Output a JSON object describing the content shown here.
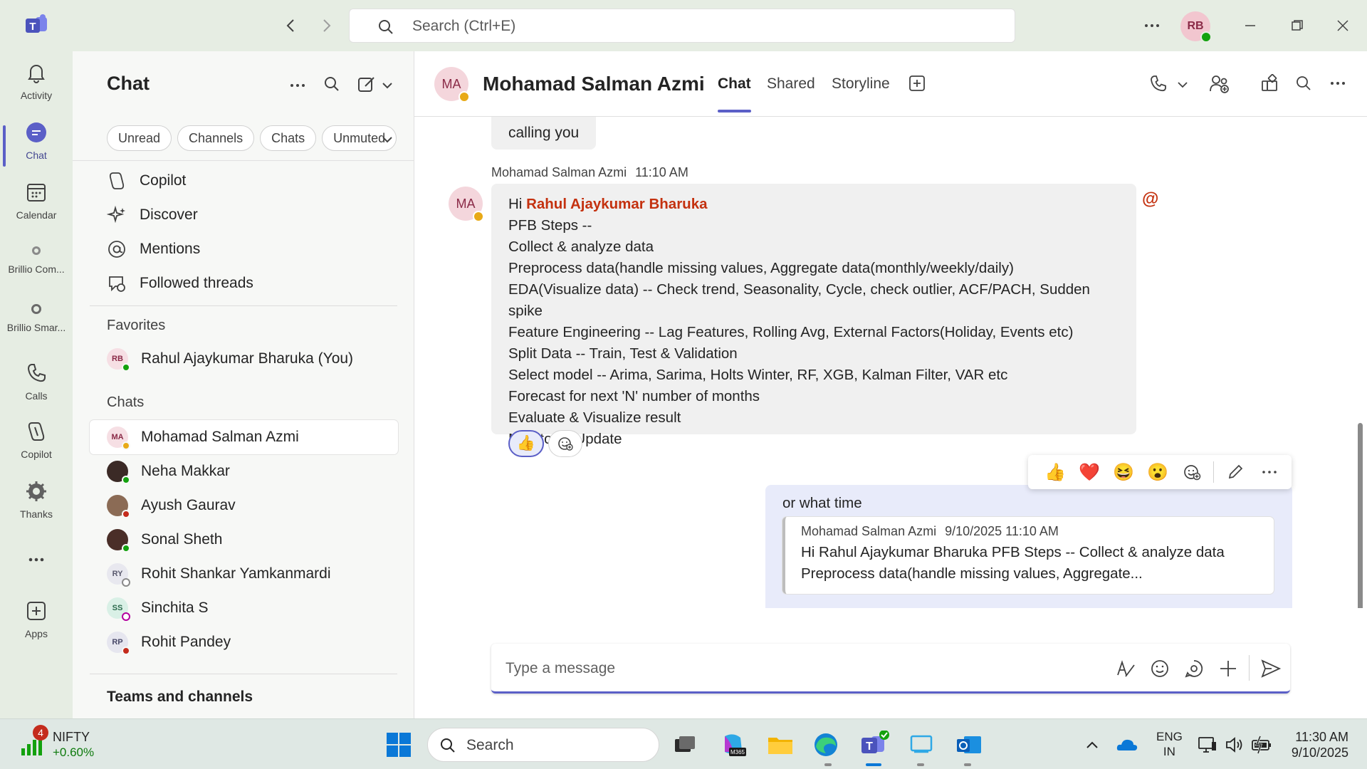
{
  "titlebar": {
    "search_placeholder": "Search (Ctrl+E)",
    "me_initials": "RB"
  },
  "rail": {
    "items": [
      {
        "label": "Activity"
      },
      {
        "label": "Chat"
      },
      {
        "label": "Calendar"
      },
      {
        "label": "Brillio Com..."
      },
      {
        "label": "Brillio Smar..."
      },
      {
        "label": "Calls"
      },
      {
        "label": "Copilot"
      },
      {
        "label": "Thanks"
      },
      {
        "label": "Apps"
      }
    ]
  },
  "sidebar": {
    "title": "Chat",
    "filters": [
      "Unread",
      "Channels",
      "Chats",
      "Unmuted"
    ],
    "nav": [
      {
        "label": "Copilot"
      },
      {
        "label": "Discover"
      },
      {
        "label": "Mentions"
      },
      {
        "label": "Followed threads"
      }
    ],
    "favorites_label": "Favorites",
    "favorites": [
      {
        "initials": "RB",
        "name": "Rahul Ajaykumar Bharuka (You)"
      }
    ],
    "chats_label": "Chats",
    "chats": [
      {
        "initials": "MA",
        "name": "Mohamad Salman Azmi"
      },
      {
        "initials": "",
        "name": "Neha Makkar"
      },
      {
        "initials": "",
        "name": "Ayush Gaurav"
      },
      {
        "initials": "",
        "name": "Sonal Sheth"
      },
      {
        "initials": "RY",
        "name": "Rohit Shankar Yamkanmardi"
      },
      {
        "initials": "SS",
        "name": "Sinchita S"
      },
      {
        "initials": "RP",
        "name": "Rohit Pandey"
      }
    ],
    "teams_label": "Teams and channels"
  },
  "header": {
    "initials": "MA",
    "name": "Mohamad Salman Azmi",
    "tabs": [
      "Chat",
      "Shared",
      "Storyline"
    ]
  },
  "thread": {
    "prev_bubble": "calling you",
    "sender": "Mohamad Salman Azmi",
    "time": "11:10 AM",
    "avatar": "MA",
    "greeting": "Hi",
    "mention": "Rahul Ajaykumar Bharuka",
    "mention_icon": "@",
    "lines": [
      "PFB Steps --",
      "Collect & analyze data",
      "Preprocess data(handle missing values, Aggregate data(monthly/weekly/daily)",
      "EDA(Visualize data) -- Check trend, Seasonality, Cycle, check outlier, ACF/PACH, Sudden spike",
      "Feature Engineering -- Lag Features, Rolling Avg, External Factors(Holiday, Events etc)",
      "Split Data -- Train, Test & Validation",
      "Select model --  Arima, Sarima, Holts Winter, RF, XGB, Kalman Filter, VAR etc",
      "Forecast for next 'N' number of months",
      "Evaluate & Visualize result",
      "Monitor & Update"
    ],
    "reaction": "👍",
    "reaction_bar": [
      "👍",
      "❤️",
      "😆",
      "😮"
    ],
    "reply": {
      "text": "or what time",
      "quote_sender": "Mohamad Salman Azmi",
      "quote_time": "9/10/2025 11:10 AM",
      "quote_line1": "Hi Rahul Ajaykumar Bharuka PFB Steps -- Collect & analyze data",
      "quote_line2": "Preprocess data(handle missing values, Aggregate..."
    }
  },
  "compose": {
    "placeholder": "Type a message"
  },
  "taskbar": {
    "nifty_badge": "4",
    "nifty_name": "NIFTY",
    "nifty_change": "+0.60%",
    "search_label": "Search",
    "lang1": "ENG",
    "lang2": "IN",
    "time": "11:30 AM",
    "date": "9/10/2025"
  },
  "colors": {
    "accent": "#5b5fc7",
    "mention": "#c4310f",
    "online": "#13a10e",
    "away": "#e8a917",
    "busy": "#c42b1c"
  }
}
